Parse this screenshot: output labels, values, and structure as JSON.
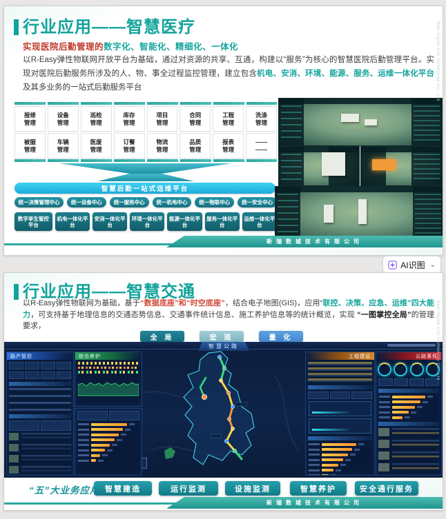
{
  "chrome": {
    "ai_button_label": "AI识图"
  },
  "footer_company": "新瑞数城技术有限公司",
  "watermark": "Best Digital City Technology Co., Ltd",
  "colors": {
    "accent_teal": "#12a39b",
    "cyan_bar": "#29c3e8",
    "subtitle_red": "#bf3a2b",
    "highlight_red": "#d24a3b",
    "button_blue": "#4f94d6"
  },
  "slide1": {
    "title": "行业应用——智慧医疗",
    "subtitle": {
      "part1": "实现医院后勤管理的",
      "part2": "数字化、智能化、精细化、一体化"
    },
    "body": {
      "s1": "以R-Easy弹性物联网开放平台为基础，通过对资源的共享、互通，构建以“服务”为核心的智慧医院后勤管理平台。实现对医院后勤服务所涉及的人、物、事全过程监控管理，建立包含",
      "s2": "机电、安消、环境、能源、服务、运维一体化平台",
      "s3": "及其多业务的一站式后勤服务平台"
    },
    "modules_row1": [
      {
        "l1": "报修",
        "l2": "管理"
      },
      {
        "l1": "设备",
        "l2": "管理"
      },
      {
        "l1": "巡检",
        "l2": "管理"
      },
      {
        "l1": "库存",
        "l2": "管理"
      },
      {
        "l1": "项目",
        "l2": "管理"
      },
      {
        "l1": "合同",
        "l2": "管理"
      },
      {
        "l1": "工程",
        "l2": "管理"
      },
      {
        "l1": "洗涤",
        "l2": "管理"
      }
    ],
    "modules_row2": [
      {
        "l1": "被服",
        "l2": "管理"
      },
      {
        "l1": "车辆",
        "l2": "管理"
      },
      {
        "l1": "医废",
        "l2": "管理"
      },
      {
        "l1": "订餐",
        "l2": "管理"
      },
      {
        "l1": "物流",
        "l2": "管理"
      },
      {
        "l1": "品质",
        "l2": "管理"
      },
      {
        "l1": "报表",
        "l2": "管理"
      },
      {
        "l1": "——",
        "l2": "——"
      }
    ],
    "funnel_label": "智慧后勤一站式运维平台",
    "centers": [
      "统一决策管理中心",
      "统一设备中心",
      "统一服务中心",
      "统一机电中心",
      "统一物联中心",
      "统一安全中心"
    ],
    "platforms": [
      "数字孪生管控平台",
      "机电一体化平台",
      "安消一体化平台",
      "环境一体化平台",
      "能源一体化平台",
      "服务一体化平台",
      "运维一体化平台"
    ]
  },
  "slide2": {
    "title": "行业应用——智慧交通",
    "body": {
      "s1": "以R-Easy弹性物联网为基础，基于",
      "s2": "“数据底座”和“时空底座”",
      "s3": "，结合电子地图(GIS)，应用“",
      "s4": "联控、决策、应急、运维”四大能力",
      "s5": "，可支持基于地理信息的交通态势信息、交通事件统计信息、施工养护信息等的统计概览，实现 ",
      "s6": "“一图掌控全局”",
      "s7": "的管理要求，"
    },
    "view_buttons": [
      "全 局",
      "宏 观",
      "量 化"
    ],
    "dashboard": {
      "title": "智慧公路",
      "panel_left": "路产管控",
      "panel_mid": "综合养护",
      "panel_eng": "工程建设",
      "panel_event": "公路事件"
    },
    "apps_label": "“五”大业务应用",
    "apps": [
      "智慧建造",
      "运行监测",
      "设施监测",
      "智慧养护",
      "安全通行服务"
    ]
  }
}
